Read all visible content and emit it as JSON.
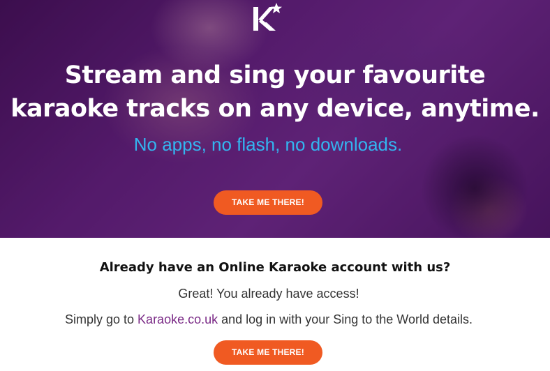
{
  "hero": {
    "title_line1": "Stream and sing your favourite",
    "title_line2": "karaoke tracks on any device, anytime.",
    "subtitle": "No apps, no flash, no downloads.",
    "cta_label": "TAKE ME THERE!",
    "logo_icon": "karaoke-k-star-icon"
  },
  "info": {
    "heading": "Already have an Online Karaoke account with us?",
    "line1": "Great! You already have access!",
    "line2_prefix": "Simply go to ",
    "line2_link": "Karaoke.co.uk",
    "line2_suffix": " and log in with your Sing to the World details.",
    "cta_label": "TAKE ME THERE!"
  },
  "colors": {
    "accent_orange": "#f05a22",
    "subtitle_blue": "#33b5f0",
    "hero_purple": "#5b1f73",
    "link_purple": "#7a2a86"
  }
}
